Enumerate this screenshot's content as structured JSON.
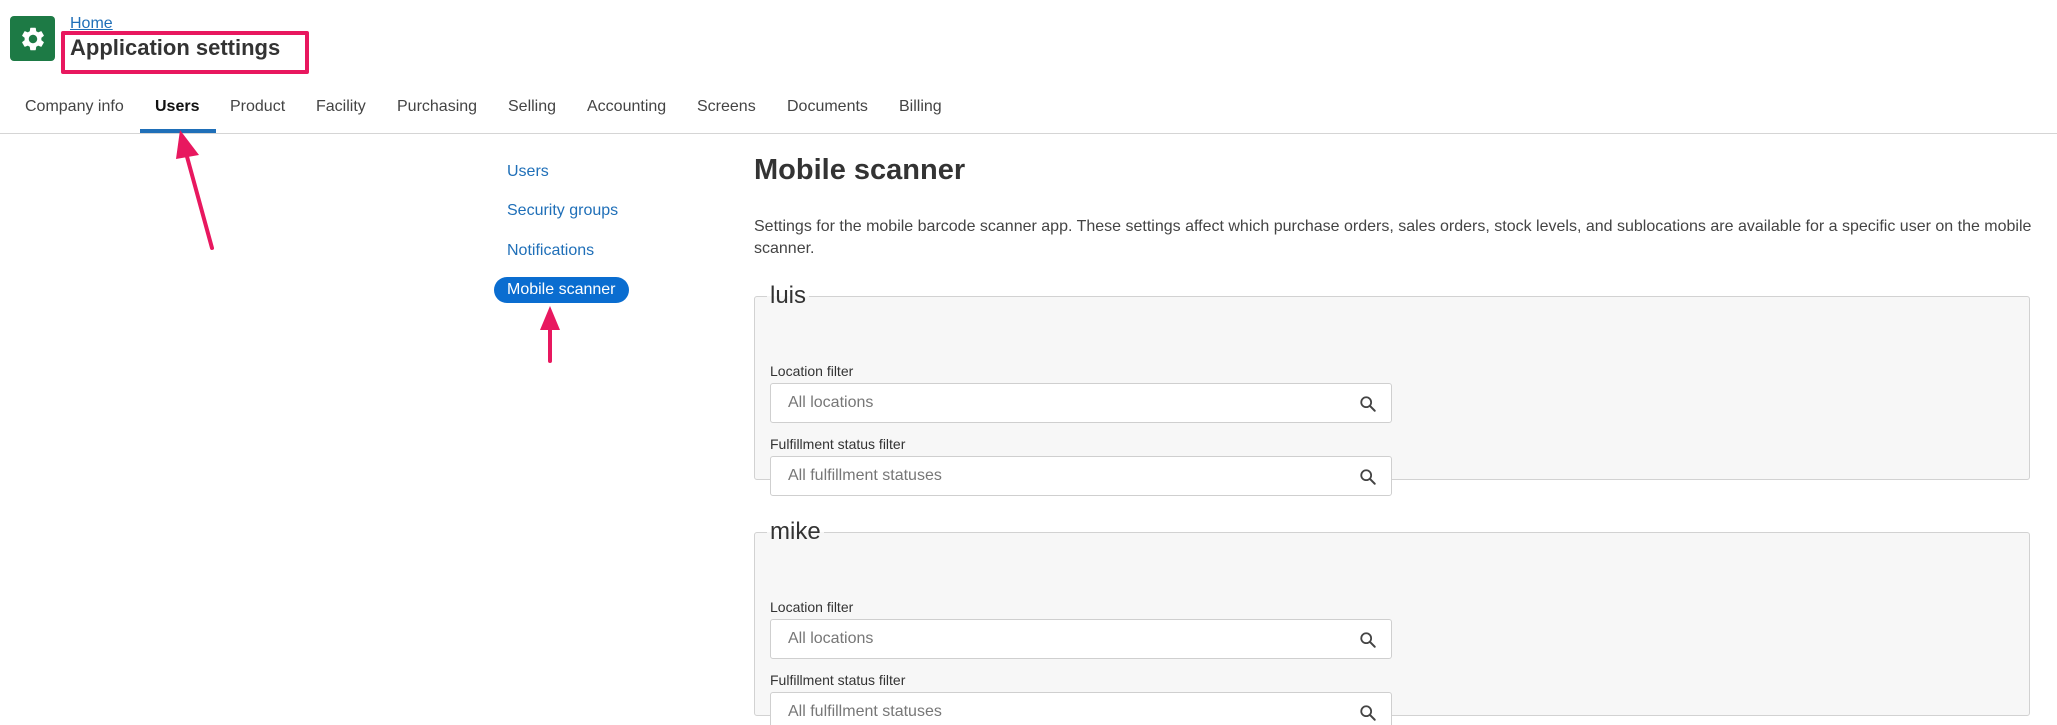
{
  "header": {
    "breadcrumb": "Home",
    "title": "Application settings",
    "icon": "gear-icon",
    "accent_color": "#1d7a45",
    "highlight_color": "#e8185f"
  },
  "tabs": [
    {
      "label": "Company info",
      "active": false
    },
    {
      "label": "Users",
      "active": true
    },
    {
      "label": "Product",
      "active": false
    },
    {
      "label": "Facility",
      "active": false
    },
    {
      "label": "Purchasing",
      "active": false
    },
    {
      "label": "Selling",
      "active": false
    },
    {
      "label": "Accounting",
      "active": false
    },
    {
      "label": "Screens",
      "active": false
    },
    {
      "label": "Documents",
      "active": false
    },
    {
      "label": "Billing",
      "active": false
    }
  ],
  "sidenav": {
    "items": [
      {
        "label": "Users",
        "active": false
      },
      {
        "label": "Security groups",
        "active": false
      },
      {
        "label": "Notifications",
        "active": false
      },
      {
        "label": "Mobile scanner",
        "active": true
      }
    ]
  },
  "main": {
    "title": "Mobile scanner",
    "description": "Settings for the mobile barcode scanner app. These settings affect which purchase orders, sales orders, stock levels, and sublocations are available for a specific user on the mobile scanner.",
    "users": [
      {
        "name": "luis",
        "location_label": "Location filter",
        "location_placeholder": "All locations",
        "fulfillment_label": "Fulfillment status filter",
        "fulfillment_placeholder": "All fulfillment statuses"
      },
      {
        "name": "mike",
        "location_label": "Location filter",
        "location_placeholder": "All locations",
        "fulfillment_label": "Fulfillment status filter",
        "fulfillment_placeholder": "All fulfillment statuses"
      }
    ]
  },
  "colors": {
    "link": "#1f6fb8",
    "active_pill": "#0a6dd0",
    "annotation_arrow": "#e8185f"
  }
}
